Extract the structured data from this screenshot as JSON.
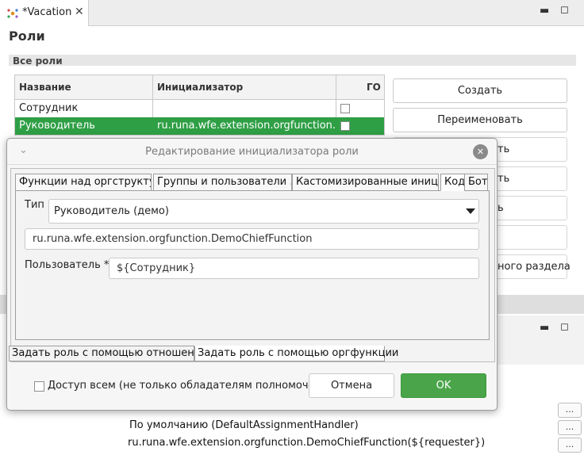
{
  "editor_tab": {
    "title": "*Vacation",
    "close_glyph": "✕"
  },
  "view_controls": {
    "minimize": "▬",
    "maximize": "◻"
  },
  "roles_section": {
    "title": "Роли",
    "subtitle": "Все роли",
    "columns": [
      "Название",
      "Инициализатор",
      "ГО"
    ],
    "rows": [
      {
        "name": "Сотрудник",
        "initializer": "",
        "checked": false,
        "selected": false
      },
      {
        "name": "Руководитель",
        "initializer": "ru.runa.wfe.extension.orgfunction.DemoChiefFunction",
        "checked": false,
        "selected": true
      }
    ],
    "buttons": [
      "Создать",
      "Переименовать"
    ],
    "partial_button_texts": [
      "ть",
      "ть",
      "ь",
      "ного раздела"
    ]
  },
  "bottom_area": {
    "line1": "По умолчанию (DefaultAssignmentHandler)",
    "line2": "ru.runa.wfe.extension.orgfunction.DemoChiefFunction(${requester})",
    "dots": "..."
  },
  "dialog": {
    "title": "Редактирование инициализатора роли",
    "chevron": "⌄",
    "close_glyph": "✕",
    "tabs": [
      "Функции над оргструкту…",
      "Группы и пользователи …",
      "Кастомизированные иниц…",
      "Код",
      "Бот"
    ],
    "active_tab": "Код",
    "type_label": "Тип",
    "type_value": "Руководитель (демо)",
    "class_value": "ru.runa.wfe.extension.orgfunction.DemoChiefFunction",
    "user_label": "Пользователь *:",
    "user_value": "${Сотрудник}",
    "bottom_tabs": [
      "Задать роль с помощью отношения",
      "Задать роль с помощью оргфункции"
    ],
    "active_bottom_tab": "Задать роль с помощью оргфункции",
    "public_access_label": "Доступ всем (не только обладателям полномочий)",
    "cancel_label": "Отмена",
    "ok_label": "OK"
  },
  "colors": {
    "accent": "#4aa54a",
    "selection": "#2f9f45"
  }
}
